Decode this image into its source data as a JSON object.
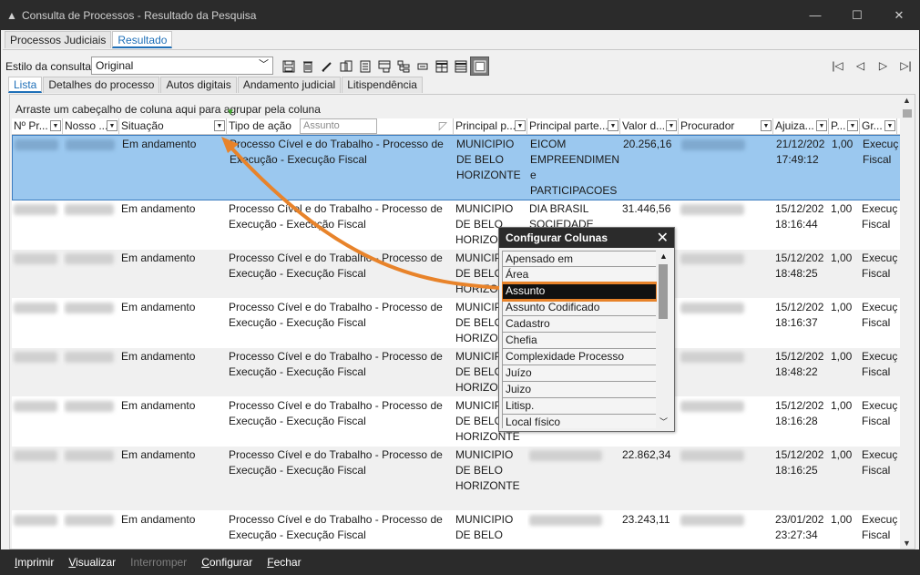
{
  "window": {
    "title": "Consulta de Processos - Resultado da Pesquisa",
    "minimize_glyph": "—",
    "maximize_glyph": "☐",
    "close_glyph": "✕"
  },
  "top_tabs": [
    {
      "label": "Processos Judiciais",
      "active": false
    },
    {
      "label": "Resultado",
      "active": true
    }
  ],
  "style": {
    "label": "Estilo da consulta",
    "value": "Original"
  },
  "sub_tabs": [
    {
      "label": "Lista",
      "active": true
    },
    {
      "label": "Detalhes do processo",
      "active": false
    },
    {
      "label": "Autos digitais",
      "active": false
    },
    {
      "label": "Andamento judicial",
      "active": false
    },
    {
      "label": "Litispendência",
      "active": false
    }
  ],
  "grid": {
    "group_hint": "Arraste um cabeçalho de coluna aqui para agrupar pela coluna",
    "drag_column": "Assunto",
    "headers": [
      "Nº Pr...",
      "Nosso ...",
      "Situação",
      "Tipo de ação",
      "Principal p...",
      "Principal parte...",
      "Valor d...",
      "Procurador",
      "Ajuiza...",
      "P...",
      "Gr..."
    ],
    "rows": [
      {
        "situacao": "Em andamento",
        "tipo": "Processo Cível e do Trabalho - Processo de Execução - Execução Fiscal",
        "principal": "MUNICIPIO DE BELO HORIZONTE",
        "parte": "EICOM EMPREENDIMEN e PARTICIPACOES",
        "valor": "20.256,16",
        "data": "21/12/202",
        "hora": "17:49:12",
        "p": "1,00",
        "gr": "Execução Fiscal"
      },
      {
        "situacao": "Em andamento",
        "tipo": "Processo Cível e do Trabalho - Processo de Execução - Execução Fiscal",
        "principal": "MUNICIPIO DE BELO HORIZONTE",
        "parte": "DIA BRASIL SOCIEDADE",
        "valor": "31.446,56",
        "data": "15/12/202",
        "hora": "18:16:44",
        "p": "1,00",
        "gr": "Execução Fiscal"
      },
      {
        "situacao": "Em andamento",
        "tipo": "Processo Cível e do Trabalho - Processo de Execução - Execução Fiscal",
        "principal": "MUNICIPIO DE BELO HORIZONTE",
        "parte": "",
        "valor": "",
        "data": "15/12/202",
        "hora": "18:48:25",
        "p": "1,00",
        "gr": "Execução Fiscal"
      },
      {
        "situacao": "Em andamento",
        "tipo": "Processo Cível e do Trabalho - Processo de Execução - Execução Fiscal",
        "principal": "MUNICIPIO DE BELO HORIZONTE",
        "parte": "",
        "valor": "",
        "data": "15/12/202",
        "hora": "18:16:37",
        "p": "1,00",
        "gr": "Execução Fiscal"
      },
      {
        "situacao": "Em andamento",
        "tipo": "Processo Cível e do Trabalho - Processo de Execução - Execução Fiscal",
        "principal": "MUNICIPIO DE BELO HORIZONTE",
        "parte": "",
        "valor": "",
        "data": "15/12/202",
        "hora": "18:48:22",
        "p": "1,00",
        "gr": "Execução Fiscal"
      },
      {
        "situacao": "Em andamento",
        "tipo": "Processo Cível e do Trabalho - Processo de Execução - Execução Fiscal",
        "principal": "MUNICIPIO DE BELO HORIZONTE",
        "parte": "",
        "valor": "",
        "data": "15/12/202",
        "hora": "18:16:28",
        "p": "1,00",
        "gr": "Execução Fiscal"
      },
      {
        "situacao": "Em andamento",
        "tipo": "Processo Cível e do Trabalho - Processo de Execução - Execução Fiscal",
        "principal": "MUNICIPIO DE BELO HORIZONTE",
        "parte": "",
        "valor": "22.862,34",
        "data": "15/12/202",
        "hora": "18:16:25",
        "p": "1,00",
        "gr": "Execução Fiscal"
      },
      {
        "situacao": "Em andamento",
        "tipo": "Processo Cível e do Trabalho - Processo de Execução - Execução Fiscal",
        "principal": "MUNICIPIO DE BELO",
        "parte": "",
        "valor": "23.243,11",
        "data": "23/01/202",
        "hora": "23:27:34",
        "p": "1,00",
        "gr": "Execução Fiscal"
      }
    ]
  },
  "popup": {
    "title": "Configurar Colunas",
    "close_glyph": "✕",
    "items": [
      "Apensado em",
      "Área",
      "Assunto",
      "Assunto Codificado",
      "Cadastro",
      "Chefia",
      "Complexidade Processo",
      "Juízo",
      "Juizo",
      "Litisp.",
      "Local físico"
    ],
    "selected_index": 2
  },
  "footer": [
    {
      "label": "Imprimir",
      "key": "I",
      "rest": "mprimir",
      "disabled": false
    },
    {
      "label": "Visualizar",
      "key": "V",
      "rest": "isualizar",
      "disabled": false
    },
    {
      "label": "Interromper",
      "key": "",
      "rest": "Interromper",
      "disabled": true
    },
    {
      "label": "Configurar",
      "key": "C",
      "rest": "onfigurar",
      "disabled": false
    },
    {
      "label": "Fechar",
      "key": "F",
      "rest": "echar",
      "disabled": false
    }
  ],
  "colors": {
    "accent_tab": "#1e6fb8",
    "selected_row": "#9bc8ef",
    "highlight_arrow": "#e8832a",
    "drop_marker": "#44a832"
  },
  "icons": [
    "save-icon",
    "delete-icon",
    "edit-icon",
    "export-icon",
    "report-icon",
    "layout-icon",
    "tree-icon",
    "minus-icon",
    "table-icon",
    "list-icon",
    "config-icon",
    "first-icon",
    "prev-icon",
    "next-icon",
    "last-icon"
  ]
}
